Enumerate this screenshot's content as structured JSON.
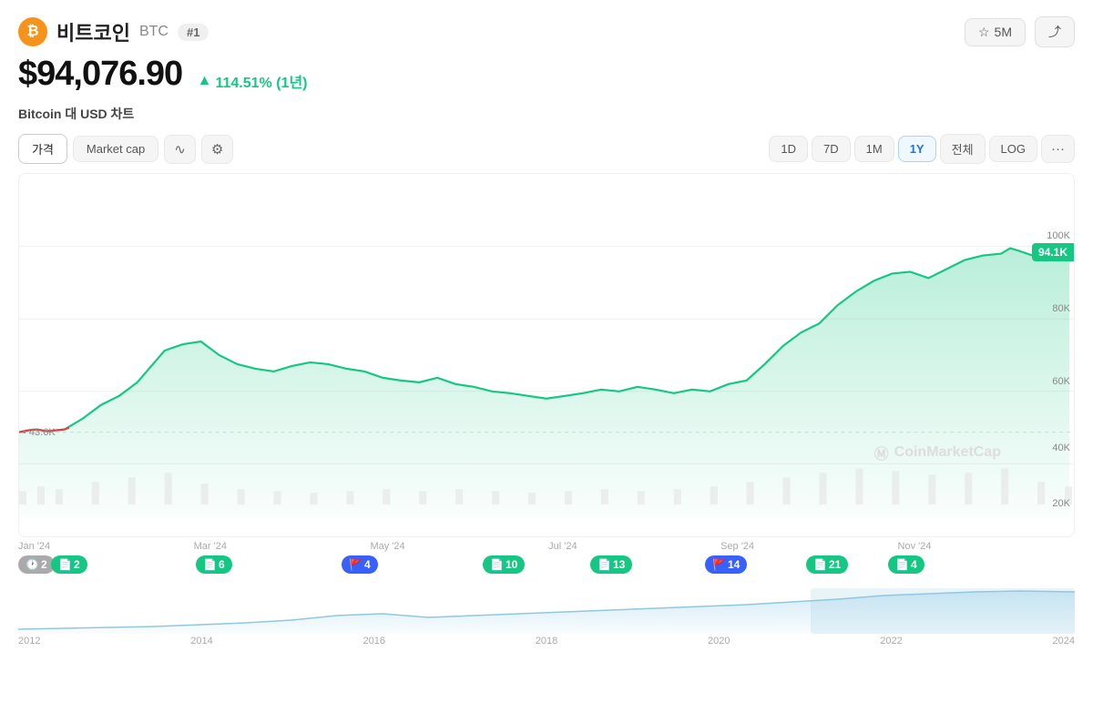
{
  "header": {
    "coin_name": "비트코인",
    "coin_symbol": "BTC",
    "rank": "#1",
    "watch_label": "5M",
    "share_label": "공유"
  },
  "price": {
    "current": "$94,076.90",
    "change_pct": "114.51% (1년)",
    "change_arrow": "▲"
  },
  "chart_title": "Bitcoin 대 USD 차트",
  "controls": {
    "left_tabs": [
      "가격",
      "Market cap"
    ],
    "chart_type_line": "∿",
    "chart_type_candle": "⚙",
    "time_buttons": [
      "1D",
      "7D",
      "1M",
      "1Y",
      "전체",
      "LOG"
    ],
    "active_time": "1Y"
  },
  "chart": {
    "y_labels_left": [
      "43.6K"
    ],
    "y_labels_right": [
      "100K",
      "80K",
      "60K",
      "40K",
      "20K"
    ],
    "current_price_badge": "94.1K",
    "watermark": "CoinMarketCap",
    "x_labels": [
      "Jan '24",
      "Mar '24",
      "May '24",
      "Jul '24",
      "Sep '24",
      "Nov '24"
    ]
  },
  "event_badges": [
    {
      "id": 1,
      "type": "gray",
      "icon": "🕐",
      "count": "2",
      "x_pct": 1
    },
    {
      "id": 2,
      "type": "green",
      "icon": "📄",
      "count": "2",
      "x_pct": 1.5
    },
    {
      "id": 3,
      "type": "green",
      "icon": "📄",
      "count": "6",
      "x_pct": 20
    },
    {
      "id": 4,
      "type": "blue",
      "icon": "🚩",
      "count": "4",
      "x_pct": 36
    },
    {
      "id": 5,
      "type": "green",
      "icon": "📄",
      "count": "10",
      "x_pct": 52
    },
    {
      "id": 6,
      "type": "green",
      "icon": "📄",
      "count": "13",
      "x_pct": 64
    },
    {
      "id": 7,
      "type": "blue",
      "icon": "🚩",
      "count": "14",
      "x_pct": 77
    },
    {
      "id": 8,
      "type": "green",
      "icon": "📄",
      "count": "21",
      "x_pct": 88
    },
    {
      "id": 9,
      "type": "green",
      "icon": "📄",
      "count": "4",
      "x_pct": 97
    }
  ],
  "bottom_axis": [
    "2012",
    "2014",
    "2016",
    "2018",
    "2020",
    "2022",
    "2024"
  ]
}
